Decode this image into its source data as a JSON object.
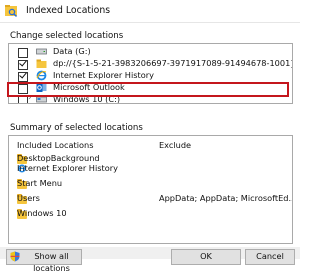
{
  "window": {
    "title": "Indexed Locations"
  },
  "change_section": {
    "label": "Change selected locations",
    "items": [
      {
        "label": "Data (G:)",
        "checked": false,
        "expandable": false,
        "icon": "drive-icon"
      },
      {
        "label": "dp://{S-1-5-21-3983206697-3971917089-91494678-1001}/",
        "checked": true,
        "expandable": false,
        "icon": "folder-icon"
      },
      {
        "label": "Internet Explorer History",
        "checked": true,
        "expandable": false,
        "icon": "ie-icon"
      },
      {
        "label": "Microsoft Outlook",
        "checked": false,
        "expandable": false,
        "icon": "outlook-icon"
      },
      {
        "label": "Windows 10 (C:)",
        "checked": false,
        "expandable": true,
        "icon": "drive-icon"
      }
    ],
    "highlight_color": "#c4161c"
  },
  "summary_section": {
    "label": "Summary of selected locations",
    "columns": {
      "included": "Included Locations",
      "exclude": "Exclude"
    },
    "rows": [
      {
        "name": "DesktopBackground",
        "exclude": ""
      },
      {
        "name": "Internet Explorer History",
        "exclude": ""
      },
      {
        "name": "Start Menu",
        "exclude": ""
      },
      {
        "name": "Users",
        "exclude": "AppData; AppData; MicrosoftEd..."
      },
      {
        "name": "Windows 10",
        "exclude": ""
      }
    ]
  },
  "footer": {
    "show_all_label": "Show all locations",
    "ok_label": "OK",
    "cancel_label": "Cancel"
  }
}
